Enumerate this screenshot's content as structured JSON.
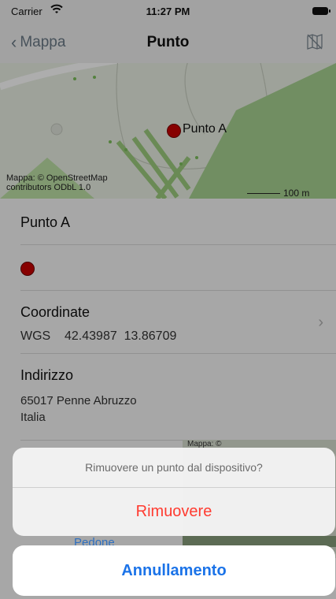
{
  "status_bar": {
    "carrier": "Carrier",
    "time": "11:27 PM"
  },
  "nav": {
    "back_label": "Mappa",
    "title": "Punto",
    "map_icon": "map-outline-icon"
  },
  "map": {
    "pin_label": "Punto A",
    "attribution_line1": "Mappa: © OpenStreetMap",
    "attribution_line2": "contributors ODbL 1.0",
    "scale_label": "100 m"
  },
  "details": {
    "name": "Punto A",
    "marker_color": "#c70000",
    "coordinates_header": "Coordinate",
    "coordinates_value": "WGS    42.43987  13.86709",
    "address_header": "Indirizzo",
    "address_line1": "65017 Penne Abruzzo",
    "address_line2": "Italia",
    "minimap_attribution": "Mappa: ©"
  },
  "action_sheet": {
    "message": "Rimuovere un punto dal dispositivo?",
    "remove_label": "Rimuovere",
    "cancel_label": "Annullamento",
    "peek_label": "Pedone"
  },
  "colors": {
    "destructive": "#ff3b30",
    "accent": "#1b73e8"
  }
}
